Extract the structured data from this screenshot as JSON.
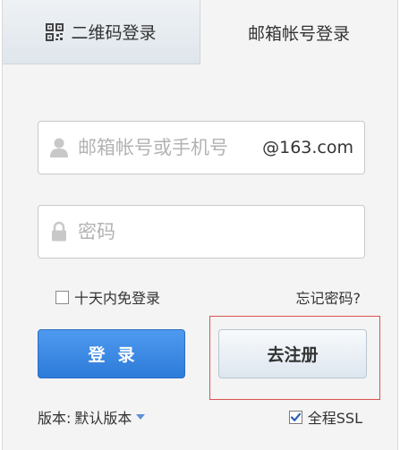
{
  "tabs": {
    "qr_label": "二维码登录",
    "mail_label": "邮箱帐号登录"
  },
  "form": {
    "username_placeholder": "邮箱帐号或手机号",
    "username_value": "",
    "domain_suffix": "@163.com",
    "password_placeholder": "密码",
    "password_value": "",
    "remember_label": "十天内免登录",
    "remember_checked": false,
    "forgot_label": "忘记密码?"
  },
  "buttons": {
    "login_label": "登录",
    "register_label": "去注册"
  },
  "footer": {
    "version_prefix": "版本:",
    "version_value": "默认版本",
    "ssl_label": "全程SSL",
    "ssl_checked": true
  },
  "colors": {
    "login_button": "#2d7bd9",
    "highlight_border": "#d9534f"
  },
  "icons": [
    "qr-code-icon",
    "user-icon",
    "lock-icon",
    "caret-down-icon",
    "checkmark-icon"
  ]
}
